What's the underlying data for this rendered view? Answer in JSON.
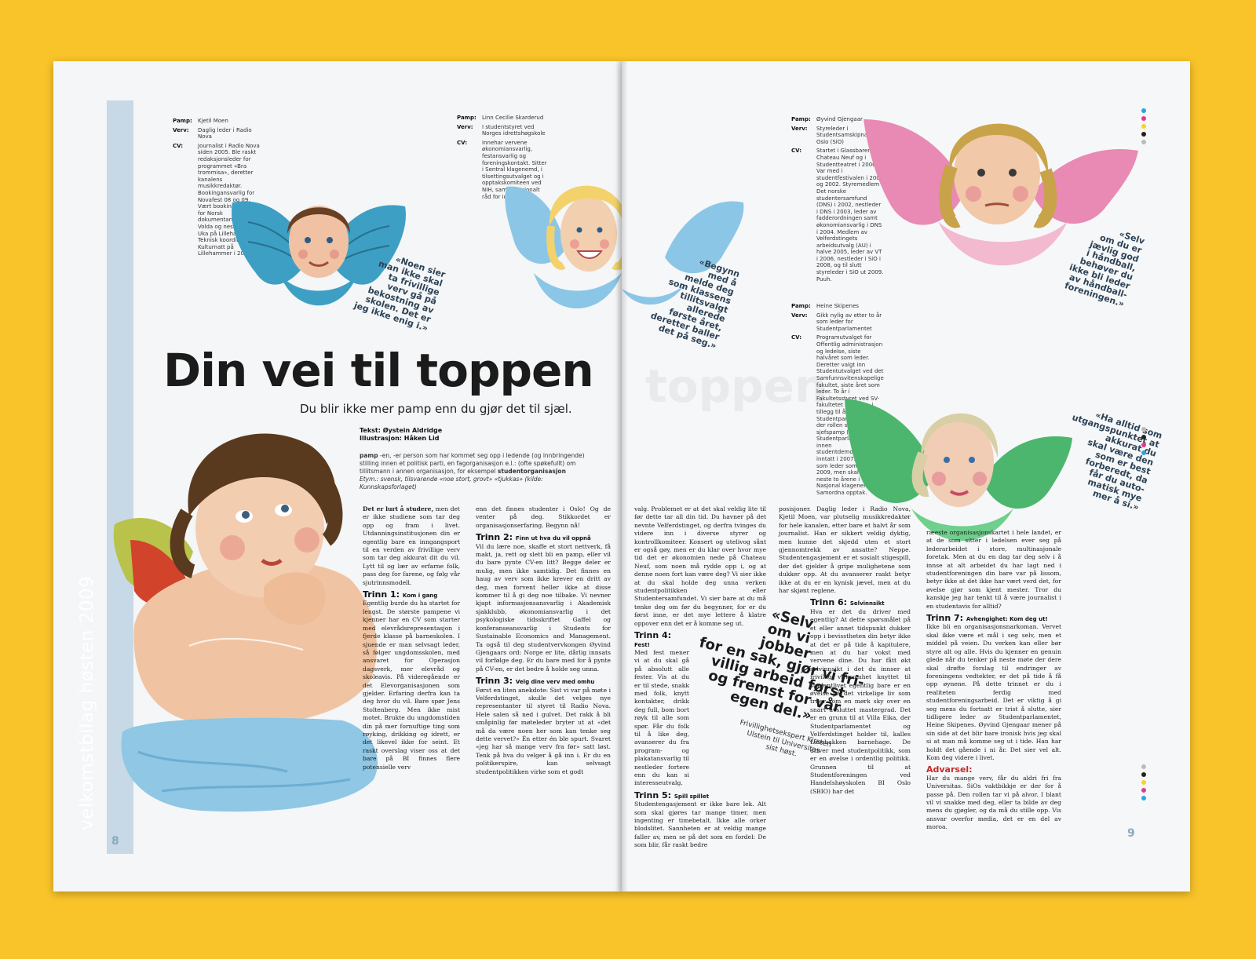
{
  "spread": {
    "headline": "Din vei til toppen",
    "headline_ghost": "toppen",
    "subhead": "Du blir ikke mer pamp enn du gjør det til sjæl.",
    "credit_text": "Tekst: Øystein Aldridge",
    "credit_illus": "Illustrasjon: Håken Lid",
    "definition": {
      "word": "pamp",
      "body": " -en, -er person som har kommet seg opp i ledende (og innbringende) stilling innen et politisk parti, en fagorganisasjon e.l.: (ofte spøkefullt) om tillitsmann i annen organisasjon, for eksempel ",
      "em": "studentorganisasjon",
      "etym": "Etym.: svensk, tilsvarende «noe stort, grovt» «tjukkas» (kilde: Kunnskapsforlaget)"
    },
    "spine_label": "velkomstbilag høsten 2009",
    "folio_left": "8",
    "folio_right": "9"
  },
  "labels": {
    "pamp": "Pamp:",
    "verv": "Verv:",
    "cv": "CV:"
  },
  "profiles": [
    {
      "name": "Kjetil Moen",
      "verv": "Daglig leder i Radio Nova",
      "cv": "Journalist i Radio Nova siden 2005. Ble raskt redaksjonsleder for programmet «Bra trommisa», deretter kanalens musikkredaktør. Bookingansvarlig for Novafest 08 og 09. Vært bookingansvarlig for Norsk dokumentarfilmfestival i Volda og nestleder av Uka på Lillehammer. Teknisk koordinator for Kulturnatt på Lillehammer i 2007."
    },
    {
      "name": "Linn Cecilie Skarderud",
      "verv": "I studentstyret ved Norges idrettshøgskole",
      "cv": "Innehar vervene økonomiansvarlig, festansvarlig og foreningskontakt. Sitter i Sentral klagenemd, i tilsettingsutvalget og i opptakskomiteen ved NIH, samt i Nasjonalt råd for idrett."
    },
    {
      "name": "Øyvind Gjengaar",
      "verv": "Styreleder i Studentsamskipnaden i Oslo (SiO)",
      "cv": "Startet i Glassbaren på Chateau Neuf og i Studentteatret i 2000. Var med i studentfestivalen i 2001 og 2002. Styremedlem i Det norske studentersamfund (DNS) i 2002, nestleder i DNS i 2003, leder av fadderordningen samt økonomiansvarlig i DNS i 2004. Medlem av Velferdstingets arbeidsutvalg (AU) i halve 2005, leder av VT i 2006, nestleder i SiO i 2008, og til slutt styreleder i SiO ut 2009. Puuh."
    },
    {
      "name": "Heine Skipenes",
      "verv": "Gikk nylig av etter to år som leder for Studentparlamentet",
      "cv": "Programutvalget for Offentlig administrasjon og ledelse, siste halvåret som leder. Deretter valgt inn Studentutvalget ved det Samfunnsvitenskapelige fakultet, siste året som leder. To år i Fakultetsstyret ved SV-fakultetet samtidig, i tillegg til å sitte i Studentparlamentet, der rollen som sjefspamp (leder av Studentparlamentet) innen studentdemokratiet ble inntatt i 2007. Ferdig som leder sommeren 2009, men skal sitte de neste to årene i Nasjonal klagenemd for Samordna opptak."
    }
  ],
  "quotes": [
    [
      "«Noen sier",
      "man ikke skal",
      "ta frivillige",
      "verv gå på",
      "bekostning av",
      "skolen. Det er",
      "jeg ikke enig i.»"
    ],
    [
      "«Begynn",
      "med å",
      "melde deg",
      "som klassens",
      "tillitsvalgt",
      "allerede",
      "første året,",
      "deretter baller",
      "det på seg.»"
    ],
    [
      "«Selv",
      "om du er",
      "jævlig god",
      "i håndball,",
      "behøver du",
      "ikke bli leder",
      "av håndball-",
      "foreningen.»"
    ],
    [
      "«Ha alltid som",
      "utgangspunktet at",
      "akkurat du",
      "skal være den",
      "som er best",
      "forberedt, da",
      "får du auto-",
      "matisk mye",
      "mer å si.»"
    ]
  ],
  "pull_quote": {
    "lines": [
      "«Selv",
      "om vi",
      "jobber",
      "for en sak, gjør vi fri-",
      "villig arbeid først",
      "og fremst for vår",
      "egen del.»"
    ],
    "credit": [
      "Frivillighetsekspert Kirsten",
      "Ulstein til Universitas",
      "sist høst."
    ]
  },
  "body": {
    "col1": {
      "lead": "Det er lurt å studere,",
      "intro": " men det er ikke studiene som tar deg opp og fram i livet. Utdanningsinstitusjonen din er egentlig bare en inngangsport til en verden av frivillige verv som tar deg akkurat dit du vil. Lytt til og lær av erfarne folk, pass deg for farene, og følg vår sjutrinnsmodell.",
      "t1": "Trinn 1:",
      "t1sub": "Kom i gang",
      "p1": "Egentlig burde du ha startet for lengst. De største pampene vi kjenner har en CV som starter med elevrådsrepresentasjon i fjerde klasse på barneskolen. I sjuende er man selvsagt leder, så følger ungdomsskolen, med ansvaret for Operasjon dagsverk, mer elevråd og skoleavis. På videregående er det Elevorganisasjonen som gjelder. Erfaring derfra kan ta deg hvor du vil. Bare spør Jens Stoltenberg. Men ikke mist motet. Brukte du ungdomstiden din på mer fornuftige ting som røyking, drikking og idrett, er det likevel ikke for seint. Et raskt overslag viser oss at det bare på BI finnes flere potensielle verv"
    },
    "col2": {
      "p0": "enn det finnes studenter i Oslo! Og de venter på deg. Stikkordet er organisasjonserfaring. Begynn nå!",
      "t2": "Trinn 2:",
      "t2sub": "Finn ut hva du vil oppnå",
      "p2": "Vil du lære noe, skaffe et stort nettverk, få makt, ja, rett og slett bli en pamp, eller vil du bare pynte CV-en litt? Begge deler er mulig, men ikke samtidig. Det finnes en haug av verv som ikke krever en dritt av deg, men forvent heller ikke at disse kommer til å gi deg noe tilbake. Vi nevner kjapt informasjonsansvarlig i Akademisk sjakklubb, økonomiansvarlig i det psykologiske tidsskriftet Gaffel og konferanseansvarlig i Students for Sustainable Economics and Management. Ta også til deg studentvervkongen Øyvind Gjengaars ord: Norge er lite, dårlig innsats vil forfølge deg. Er du bare med for å pynte på CV-en, er det bedre å holde seg unna.",
      "t3": "Trinn 3:",
      "t3sub": "Velg dine verv med omhu",
      "p3": "Først en liten anekdote: Sist vi var på møte i Velferdstinget, skulle det velges nye representanter til styret til Radio Nova. Hele salen så ned i gulvet. Det rakk å bli småpinlig før møteleder bryter ut at «det må da være noen her som kan tenke seg dette vervet?» Én etter én ble spurt. Svaret «jeg har så mange verv fra før» satt løst. Tenk på hva du velger å gå inn i. Er du en politikerspire, kan selvsagt studentpolitikken virke som et godt"
    },
    "col3": {
      "p0": "valg. Problemet er at det skal veldig lite til før dette tar all din tid. Du havner på det nevnte Velferdstinget, og derfra tvinges du videre inn i diverse styrer og kontrollkomiteer. Konsert og utelivog sånt er også gøy, men er du klar over hvor mye tid det er økonomien nede på Chateau Neuf, som noen må rydde opp i, og at denne noen fort kan være deg? Vi sier ikke at du skal holde deg unna verken studentpolitikken eller Studentersamfundet. Vi sier bare at du må tenke deg om før du begynner, for er du først inne, er det mye lettere å klatre oppover enn det er å komme seg ut.",
      "t4": "Trinn 4:",
      "t4sub": "Fest!",
      "p4": "Med fest mener vi at du skal gå på absolutt alle fester. Vis at du er til stede, snakk med folk, knytt kontakter, drikk deg full, bom bort røyk til alle som spør. Får du folk til å like deg, avanserer du fra program- og plakatansvarlig til nestleder fortere enn du kan si interesseutvalg.",
      "t5": "Trinn 5:",
      "t5sub": "Spill spillet",
      "p5": "Studentengasjement er ikke bare lek. Alt som skal gjøres tar mange timer, men ingenting er timebetalt. Ikke alle orker blodslitet. Sannheten er at veldig mange faller av, men se på det som en fordel: De som blir, får raskt bedre"
    },
    "col4": {
      "p0": "posisjoner. Daglig leder i Radio Nova, Kjetil Moen, var plutselig musikkredaktør for hele kanalen, etter bare et halvt år som journalist. Han er sikkert veldig dyktig, men kunne det skjedd uten et stort gjennomtrekk av ansatte? Neppe. Studentengasjement er et sosialt stigespill, der det gjelder å gripe mulighetene som dukker opp. At du avanserer raskt betyr ikke at du er en kynisk jævel, men at du har skjønt reglene.",
      "t6": "Trinn 6:",
      "t6sub": "Selvinnsikt",
      "p6": "Hva er det du driver med egentlig? At dette spørsmålet på et eller annet tidspunkt dukker opp i bevisstheten din betyr ikke at det er på tide å kapitulere, men at du har vokst med vervene dine. Du har fått økt selvinnsikt i det du innser at frivillig virksomhet knyttet til studentlivet egentlig bare er en øvelse på det virkelige liv som truer som en mørk sky over en snart avsluttet mastergrad. Det er en grunn til at Villa Eika, der Studentparlamentet og Velferdstinget holder til, kalles Løvebakken barnehage. De driver med studentpolitikk, som er en øvelse i ordentlig politikk. Grunnen til at Studentforeningen ved Handelshøyskolen BI Oslo (SBIO) har det"
    },
    "col5": {
      "p0": "ræeste organisasjonskartet i hele landet, er at de som sitter i ledelsen ever seg på lederarbeidet i store, multinasjonale foretak. Men at du en dag tar deg selv i å innse at alt arbeidet du har lagt ned i studentforeningen din bare var på lissom, betyr ikke at det ikke har vært verd det, for øvelse gjør som kjent mester. Tror du kanskje jeg har tenkt til å være journalist i en studentavis for alltid?",
      "t7": "Trinn 7:",
      "t7sub": "Avhengighet: Kom deg ut!",
      "p7": "Ikke bli en organisasjonsnarkoman. Vervet skal ikke være et mål i seg selv, men et middel på veien. Du verken kan eller bør styre alt og alle. Hvis du kjenner en genuin glede når du tenker på neste møte der dere skal drøfte forslag til endringer av foreningens vedtekter, er det på tide å få opp øynene. På dette trinnet er du i realiteten ferdig med studentforeningsarbeid. Det er viktig å gi seg mens du fortsatt er trist å slutte, sier tidligere leder av Studentparlamentet, Heine Skipenes. Øyvind Gjengaar mener på sin side at det blir bare ironisk hvis jeg skal si at man må komme seg ut i tide. Han har holdt det gående i ni år. Det sier vel alt. Kom deg videre i livet.",
      "adv": "Advarsel:",
      "padv": "Har du mange verv, får du aldri fri fra Universitas. SiOs vaktbikkje er der for å passe på. Den rollen tar vi på alvor. I blant vil vi snakke med deg, eller ta bilde av deg mens du gjøgler, og da må du stille opp. Vis ansvar overfor media, det er en del av moroa."
    }
  },
  "colors": {
    "background": "#f9c42a",
    "spine": "#c7d9e6",
    "accent_red": "#c62b2b"
  }
}
